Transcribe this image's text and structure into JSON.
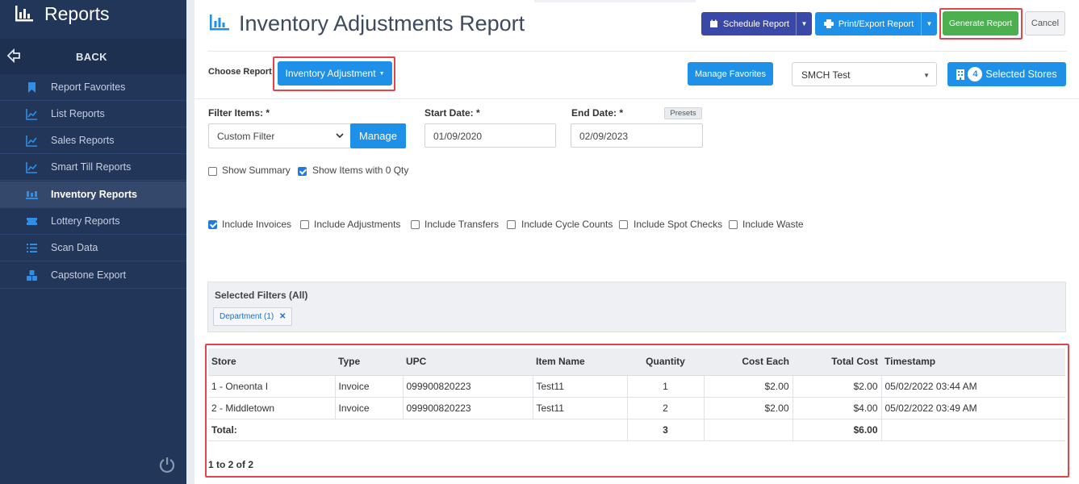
{
  "sidebar": {
    "title": "Reports",
    "back_label": "BACK",
    "items": [
      {
        "label": "Report Favorites",
        "icon": "bookmark-icon"
      },
      {
        "label": "List Reports",
        "icon": "line-chart-icon"
      },
      {
        "label": "Sales Reports",
        "icon": "line-chart-icon"
      },
      {
        "label": "Smart Till Reports",
        "icon": "line-chart-icon"
      },
      {
        "label": "Inventory Reports",
        "icon": "pallet-icon",
        "active": true
      },
      {
        "label": "Lottery Reports",
        "icon": "ticket-icon"
      },
      {
        "label": "Scan Data",
        "icon": "list-icon"
      },
      {
        "label": "Capstone Export",
        "icon": "cubes-icon"
      }
    ]
  },
  "header": {
    "title": "Inventory Adjustments Report",
    "schedule_label": "Schedule Report",
    "print_label": "Print/Export Report",
    "generate_label": "Generate Report",
    "cancel_label": "Cancel"
  },
  "toolbar": {
    "choose_label": "Choose Report",
    "report_type": "Inventory Adjustment",
    "manage_favorites_label": "Manage Favorites",
    "store_select": "SMCH Test",
    "store_count": "4",
    "selected_stores_label": "Selected Stores"
  },
  "filters": {
    "filter_items_label": "Filter Items: *",
    "filter_value": "Custom Filter",
    "manage_label": "Manage",
    "start_label": "Start Date: *",
    "start_value": "01/09/2020",
    "end_label": "End Date: *",
    "end_value": "02/09/2023",
    "presets_label": "Presets",
    "show_summary": "Show Summary",
    "show_zero_qty": "Show Items with 0 Qty",
    "include": [
      {
        "label": "Include Invoices",
        "checked": true
      },
      {
        "label": "Include Adjustments",
        "checked": false
      },
      {
        "label": "Include Transfers",
        "checked": false
      },
      {
        "label": "Include Cycle Counts",
        "checked": false
      },
      {
        "label": "Include Spot Checks",
        "checked": false
      },
      {
        "label": "Include Waste",
        "checked": false
      }
    ]
  },
  "selected_filters": {
    "title": "Selected Filters (All)",
    "chip": "Department (1)",
    "chip_remove": "✕"
  },
  "table": {
    "columns": [
      "Store",
      "Type",
      "UPC",
      "Item Name",
      "Quantity",
      "Cost Each",
      "Total Cost",
      "Timestamp"
    ],
    "rows": [
      [
        "1 - Oneonta I",
        "Invoice",
        "099900820223",
        "Test11",
        "1",
        "$2.00",
        "$2.00",
        "05/02/2022 03:44 AM"
      ],
      [
        "2 - Middletown",
        "Invoice",
        "099900820223",
        "Test11",
        "2",
        "$2.00",
        "$4.00",
        "05/02/2022 03:49 AM"
      ]
    ],
    "total_label": "Total:",
    "total_qty": "3",
    "total_cost": "$6.00",
    "pager": "1 to 2 of 2"
  },
  "colors": {
    "sidebar_bg": "#22365a",
    "primary": "#1e90e8",
    "schedule": "#3a49a8",
    "generate": "#4caf50",
    "highlight": "#e0454e"
  }
}
